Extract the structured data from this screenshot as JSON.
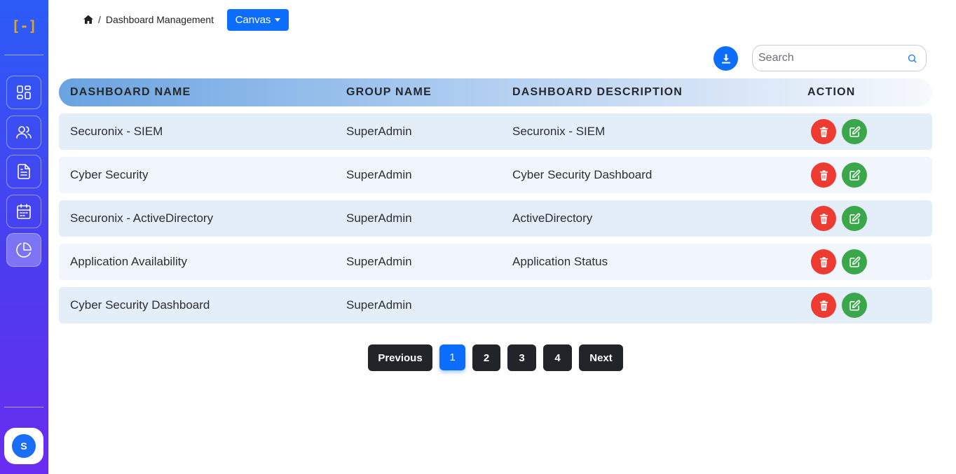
{
  "sidebar": {
    "logo": "[-]",
    "nav": [
      {
        "icon": "dashboard-grid-icon"
      },
      {
        "icon": "users-icon"
      },
      {
        "icon": "document-icon"
      },
      {
        "icon": "calendar-icon"
      },
      {
        "icon": "pie-chart-icon",
        "active": true
      }
    ],
    "avatar_initial": "S"
  },
  "header": {
    "breadcrumb_current": "Dashboard Management",
    "breadcrumb_separator": "/",
    "canvas_label": "Canvas"
  },
  "search": {
    "placeholder": "Search"
  },
  "table": {
    "columns": [
      "DASHBOARD NAME",
      "GROUP NAME",
      "DASHBOARD DESCRIPTION",
      "ACTION"
    ],
    "rows": [
      {
        "name": "Securonix - SIEM",
        "group": "SuperAdmin",
        "description": "Securonix - SIEM"
      },
      {
        "name": "Cyber Security",
        "group": "SuperAdmin",
        "description": "Cyber Security Dashboard"
      },
      {
        "name": "Securonix - ActiveDirectory",
        "group": "SuperAdmin",
        "description": "ActiveDirectory"
      },
      {
        "name": "Application Availability",
        "group": "SuperAdmin",
        "description": "Application Status"
      },
      {
        "name": "Cyber Security Dashboard",
        "group": "SuperAdmin",
        "description": ""
      }
    ]
  },
  "pagination": {
    "previous": "Previous",
    "pages": [
      "1",
      "2",
      "3",
      "4"
    ],
    "current": "1",
    "next": "Next"
  },
  "colors": {
    "primary": "#0d6efd",
    "delete": "#ee3b32",
    "edit": "#3aa84a",
    "pager_dark": "#212529"
  }
}
